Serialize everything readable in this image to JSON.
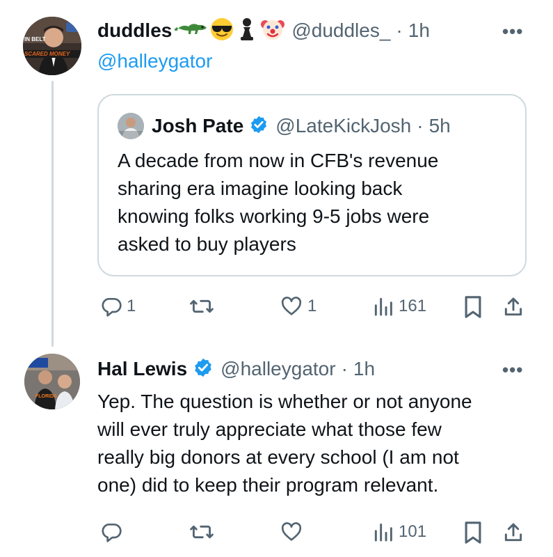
{
  "tweet1": {
    "name": "duddles",
    "badges": [
      "alligator-emoji",
      "sunglasses-emoji",
      "chess-pawn-emoji",
      "clown-emoji"
    ],
    "handle": "@duddles_",
    "sep": "·",
    "time": "1h",
    "more": "•••",
    "replying_to": "@halleygator",
    "avatar_text": {
      "top": "IN BELT",
      "bottom": "SCARED MONEY"
    },
    "quote": {
      "name": "Josh Pate",
      "handle": "@LateKickJosh",
      "sep": "·",
      "time": "5h",
      "lines": [
        "A decade from now in CFB's revenue",
        "sharing era imagine looking back",
        "knowing folks working 9-5 jobs were",
        "asked to buy players"
      ]
    },
    "actions": {
      "replies": "1",
      "reposts": "",
      "likes": "1",
      "views": "161"
    }
  },
  "tweet2": {
    "name": "Hal Lewis",
    "handle": "@halleygator",
    "sep": "·",
    "time": "1h",
    "more": "•••",
    "avatar_text": "FLORIDA",
    "lines": [
      "Yep.  The question is whether or not anyone",
      "will ever truly appreciate what those few",
      "really big donors at every school (I am not",
      "one) did to keep their program relevant."
    ],
    "actions": {
      "replies": "",
      "reposts": "",
      "likes": "",
      "views": "101"
    }
  },
  "colors": {
    "accent": "#1d9bf0",
    "muted": "#536471",
    "border": "#cfd9de"
  }
}
